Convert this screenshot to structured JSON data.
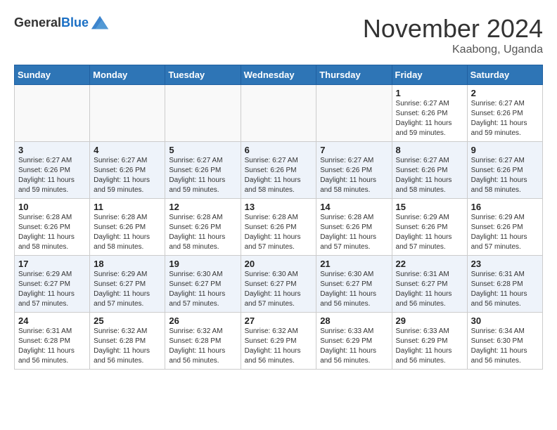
{
  "header": {
    "logo_line1": "General",
    "logo_line2": "Blue",
    "month_title": "November 2024",
    "location": "Kaabong, Uganda"
  },
  "weekdays": [
    "Sunday",
    "Monday",
    "Tuesday",
    "Wednesday",
    "Thursday",
    "Friday",
    "Saturday"
  ],
  "weeks": [
    [
      {
        "day": "",
        "info": ""
      },
      {
        "day": "",
        "info": ""
      },
      {
        "day": "",
        "info": ""
      },
      {
        "day": "",
        "info": ""
      },
      {
        "day": "",
        "info": ""
      },
      {
        "day": "1",
        "info": "Sunrise: 6:27 AM\nSunset: 6:26 PM\nDaylight: 11 hours and 59 minutes."
      },
      {
        "day": "2",
        "info": "Sunrise: 6:27 AM\nSunset: 6:26 PM\nDaylight: 11 hours and 59 minutes."
      }
    ],
    [
      {
        "day": "3",
        "info": "Sunrise: 6:27 AM\nSunset: 6:26 PM\nDaylight: 11 hours and 59 minutes."
      },
      {
        "day": "4",
        "info": "Sunrise: 6:27 AM\nSunset: 6:26 PM\nDaylight: 11 hours and 59 minutes."
      },
      {
        "day": "5",
        "info": "Sunrise: 6:27 AM\nSunset: 6:26 PM\nDaylight: 11 hours and 59 minutes."
      },
      {
        "day": "6",
        "info": "Sunrise: 6:27 AM\nSunset: 6:26 PM\nDaylight: 11 hours and 58 minutes."
      },
      {
        "day": "7",
        "info": "Sunrise: 6:27 AM\nSunset: 6:26 PM\nDaylight: 11 hours and 58 minutes."
      },
      {
        "day": "8",
        "info": "Sunrise: 6:27 AM\nSunset: 6:26 PM\nDaylight: 11 hours and 58 minutes."
      },
      {
        "day": "9",
        "info": "Sunrise: 6:27 AM\nSunset: 6:26 PM\nDaylight: 11 hours and 58 minutes."
      }
    ],
    [
      {
        "day": "10",
        "info": "Sunrise: 6:28 AM\nSunset: 6:26 PM\nDaylight: 11 hours and 58 minutes."
      },
      {
        "day": "11",
        "info": "Sunrise: 6:28 AM\nSunset: 6:26 PM\nDaylight: 11 hours and 58 minutes."
      },
      {
        "day": "12",
        "info": "Sunrise: 6:28 AM\nSunset: 6:26 PM\nDaylight: 11 hours and 58 minutes."
      },
      {
        "day": "13",
        "info": "Sunrise: 6:28 AM\nSunset: 6:26 PM\nDaylight: 11 hours and 57 minutes."
      },
      {
        "day": "14",
        "info": "Sunrise: 6:28 AM\nSunset: 6:26 PM\nDaylight: 11 hours and 57 minutes."
      },
      {
        "day": "15",
        "info": "Sunrise: 6:29 AM\nSunset: 6:26 PM\nDaylight: 11 hours and 57 minutes."
      },
      {
        "day": "16",
        "info": "Sunrise: 6:29 AM\nSunset: 6:26 PM\nDaylight: 11 hours and 57 minutes."
      }
    ],
    [
      {
        "day": "17",
        "info": "Sunrise: 6:29 AM\nSunset: 6:27 PM\nDaylight: 11 hours and 57 minutes."
      },
      {
        "day": "18",
        "info": "Sunrise: 6:29 AM\nSunset: 6:27 PM\nDaylight: 11 hours and 57 minutes."
      },
      {
        "day": "19",
        "info": "Sunrise: 6:30 AM\nSunset: 6:27 PM\nDaylight: 11 hours and 57 minutes."
      },
      {
        "day": "20",
        "info": "Sunrise: 6:30 AM\nSunset: 6:27 PM\nDaylight: 11 hours and 57 minutes."
      },
      {
        "day": "21",
        "info": "Sunrise: 6:30 AM\nSunset: 6:27 PM\nDaylight: 11 hours and 56 minutes."
      },
      {
        "day": "22",
        "info": "Sunrise: 6:31 AM\nSunset: 6:27 PM\nDaylight: 11 hours and 56 minutes."
      },
      {
        "day": "23",
        "info": "Sunrise: 6:31 AM\nSunset: 6:28 PM\nDaylight: 11 hours and 56 minutes."
      }
    ],
    [
      {
        "day": "24",
        "info": "Sunrise: 6:31 AM\nSunset: 6:28 PM\nDaylight: 11 hours and 56 minutes."
      },
      {
        "day": "25",
        "info": "Sunrise: 6:32 AM\nSunset: 6:28 PM\nDaylight: 11 hours and 56 minutes."
      },
      {
        "day": "26",
        "info": "Sunrise: 6:32 AM\nSunset: 6:28 PM\nDaylight: 11 hours and 56 minutes."
      },
      {
        "day": "27",
        "info": "Sunrise: 6:32 AM\nSunset: 6:29 PM\nDaylight: 11 hours and 56 minutes."
      },
      {
        "day": "28",
        "info": "Sunrise: 6:33 AM\nSunset: 6:29 PM\nDaylight: 11 hours and 56 minutes."
      },
      {
        "day": "29",
        "info": "Sunrise: 6:33 AM\nSunset: 6:29 PM\nDaylight: 11 hours and 56 minutes."
      },
      {
        "day": "30",
        "info": "Sunrise: 6:34 AM\nSunset: 6:30 PM\nDaylight: 11 hours and 56 minutes."
      }
    ]
  ]
}
